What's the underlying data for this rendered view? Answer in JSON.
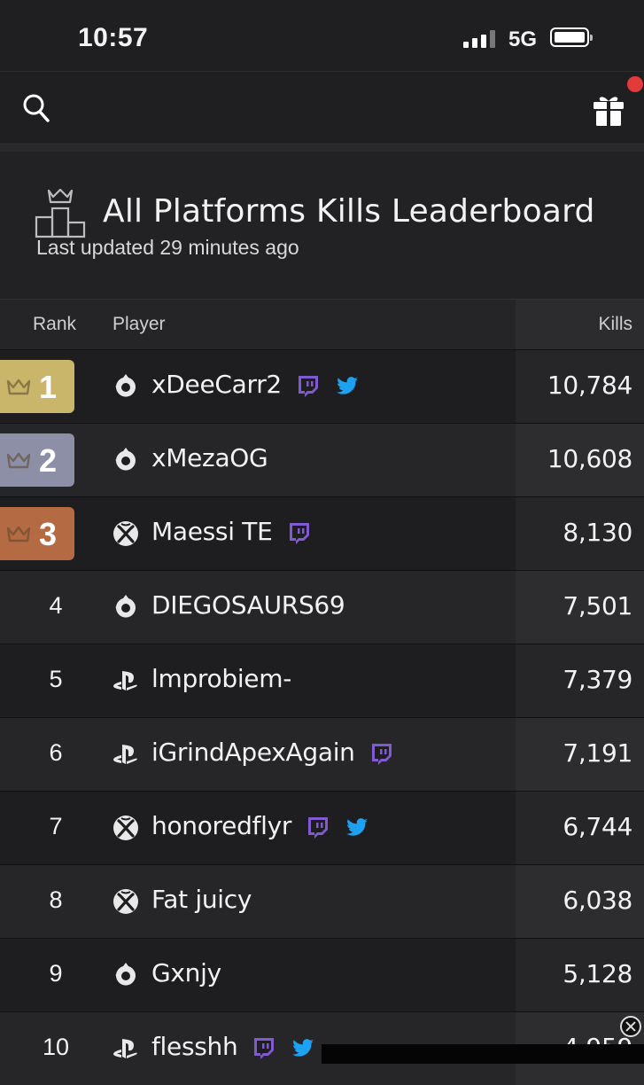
{
  "status_bar": {
    "time": "10:57",
    "network": "5G"
  },
  "header": {
    "title": "All Platforms Kills Leaderboard",
    "subtitle": "Last updated 29 minutes ago"
  },
  "table": {
    "columns": {
      "rank": "Rank",
      "player": "Player",
      "kills": "Kills"
    },
    "rows": [
      {
        "rank": "1",
        "player": "xDeeCarr2",
        "kills": "10,784",
        "platform": "origin",
        "twitch": true,
        "twitter": true,
        "badge": "gold"
      },
      {
        "rank": "2",
        "player": "xMezaOG",
        "kills": "10,608",
        "platform": "origin",
        "twitch": false,
        "twitter": false,
        "badge": "silver"
      },
      {
        "rank": "3",
        "player": "Maessi TE",
        "kills": "8,130",
        "platform": "xbox",
        "twitch": true,
        "twitter": false,
        "badge": "bronze"
      },
      {
        "rank": "4",
        "player": "DIEGOSAURS69",
        "kills": "7,501",
        "platform": "origin",
        "twitch": false,
        "twitter": false
      },
      {
        "rank": "5",
        "player": "lmprobiem-",
        "kills": "7,379",
        "platform": "playstation",
        "twitch": false,
        "twitter": false
      },
      {
        "rank": "6",
        "player": "iGrindApexAgain",
        "kills": "7,191",
        "platform": "playstation",
        "twitch": true,
        "twitter": false
      },
      {
        "rank": "7",
        "player": "honoredflyr",
        "kills": "6,744",
        "platform": "xbox",
        "twitch": true,
        "twitter": true
      },
      {
        "rank": "8",
        "player": "Fat juicy",
        "kills": "6,038",
        "platform": "xbox",
        "twitch": false,
        "twitter": false
      },
      {
        "rank": "9",
        "player": "Gxnjy",
        "kills": "5,128",
        "platform": "origin",
        "twitch": false,
        "twitter": false
      },
      {
        "rank": "10",
        "player": "flesshh",
        "kills": "4,959",
        "platform": "playstation",
        "twitch": true,
        "twitter": true
      }
    ]
  },
  "overlay": {
    "text": ""
  },
  "colors": {
    "gold": "#c9b66b",
    "silver": "#8d8fa6",
    "bronze": "#b46a43",
    "twitch": "#7f5ad1",
    "twitter": "#1da1f2",
    "notification": "#e33a3a"
  }
}
